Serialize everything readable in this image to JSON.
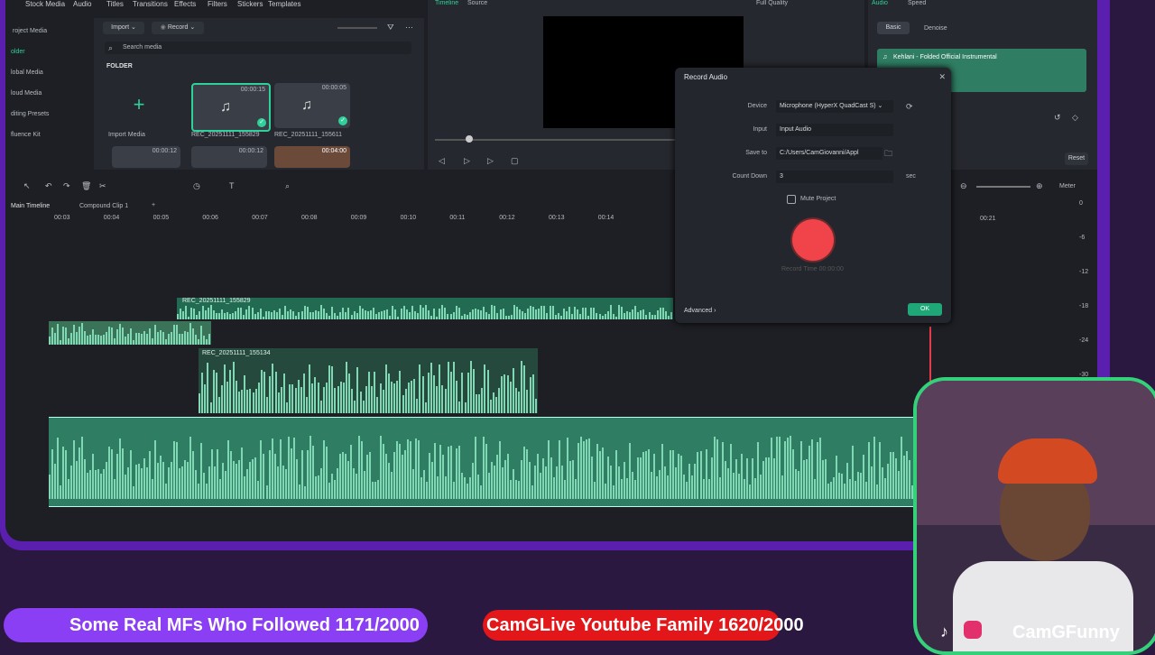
{
  "toolbar": {
    "stock_media": "Stock Media",
    "audio": "Audio",
    "titles": "Titles",
    "transitions": "Transitions",
    "effects": "Effects",
    "filters": "Filters",
    "stickers": "Stickers",
    "templates": "Templates"
  },
  "sidebar": {
    "items": [
      "roject Media",
      "older",
      "lobal Media",
      "loud Media",
      "diting Presets",
      "fluence Kit"
    ]
  },
  "media": {
    "import_label": "Import",
    "record_label": "Record",
    "search_placeholder": "Search media",
    "folder_label": "FOLDER",
    "import_media": "Import Media",
    "clips": [
      {
        "name": "REC_20251111_155829",
        "duration": "00:00:15"
      },
      {
        "name": "REC_20251111_155611",
        "duration": "00:00:05"
      }
    ],
    "row2": [
      {
        "duration": "00:00:12"
      },
      {
        "duration": "00:00:12"
      },
      {
        "duration": "00:04:00"
      }
    ]
  },
  "player": {
    "tab_timeline": "Timeline",
    "tab_source": "Source",
    "quality": "Full Quality"
  },
  "right_panel": {
    "tab_audio": "Audio",
    "tab_speed": "Speed",
    "sub_basic": "Basic",
    "sub_denoise": "Denoise",
    "track": "Kehlani - Folded Official Instrumental",
    "reset": "Reset"
  },
  "timeline": {
    "tab_main": "Main Timeline",
    "tab_compound": "Compound Clip 1",
    "add": "+",
    "meter": "Meter",
    "ruler": [
      "00:03",
      "00:04",
      "00:05",
      "00:06",
      "00:07",
      "00:08",
      "00:09",
      "00:10",
      "00:11",
      "00:12",
      "00:13",
      "00:14"
    ],
    "ruler_right": "00:21",
    "meter_labels": [
      "0",
      "-6",
      "-12",
      "-18",
      "-24",
      "-30"
    ],
    "clip1": "REC_20251111_155829",
    "clip2": "REC_20251111_155134"
  },
  "dialog": {
    "title": "Record Audio",
    "device_label": "Device",
    "device_value": "Microphone (HyperX QuadCast S)",
    "input_label": "Input",
    "input_value": "Input Audio",
    "save_label": "Save to",
    "save_value": "C:/Users/CamGiovanni/Appl",
    "countdown_label": "Count Down",
    "countdown_value": "3",
    "countdown_unit": "sec",
    "mute_label": "Mute Project",
    "record_time": "Record Time 00:00:00",
    "advanced": "Advanced",
    "ok": "OK"
  },
  "overlay": {
    "banner1": "Some Real MFs Who Followed 1171/2000",
    "banner2": "CamGLive Youtube Family 1620/2000",
    "handle": "CamGFunny"
  },
  "colors": {
    "accent": "#2fd19a",
    "record": "#f0444a",
    "purple": "#8a3ff4",
    "red": "#e3161a"
  }
}
